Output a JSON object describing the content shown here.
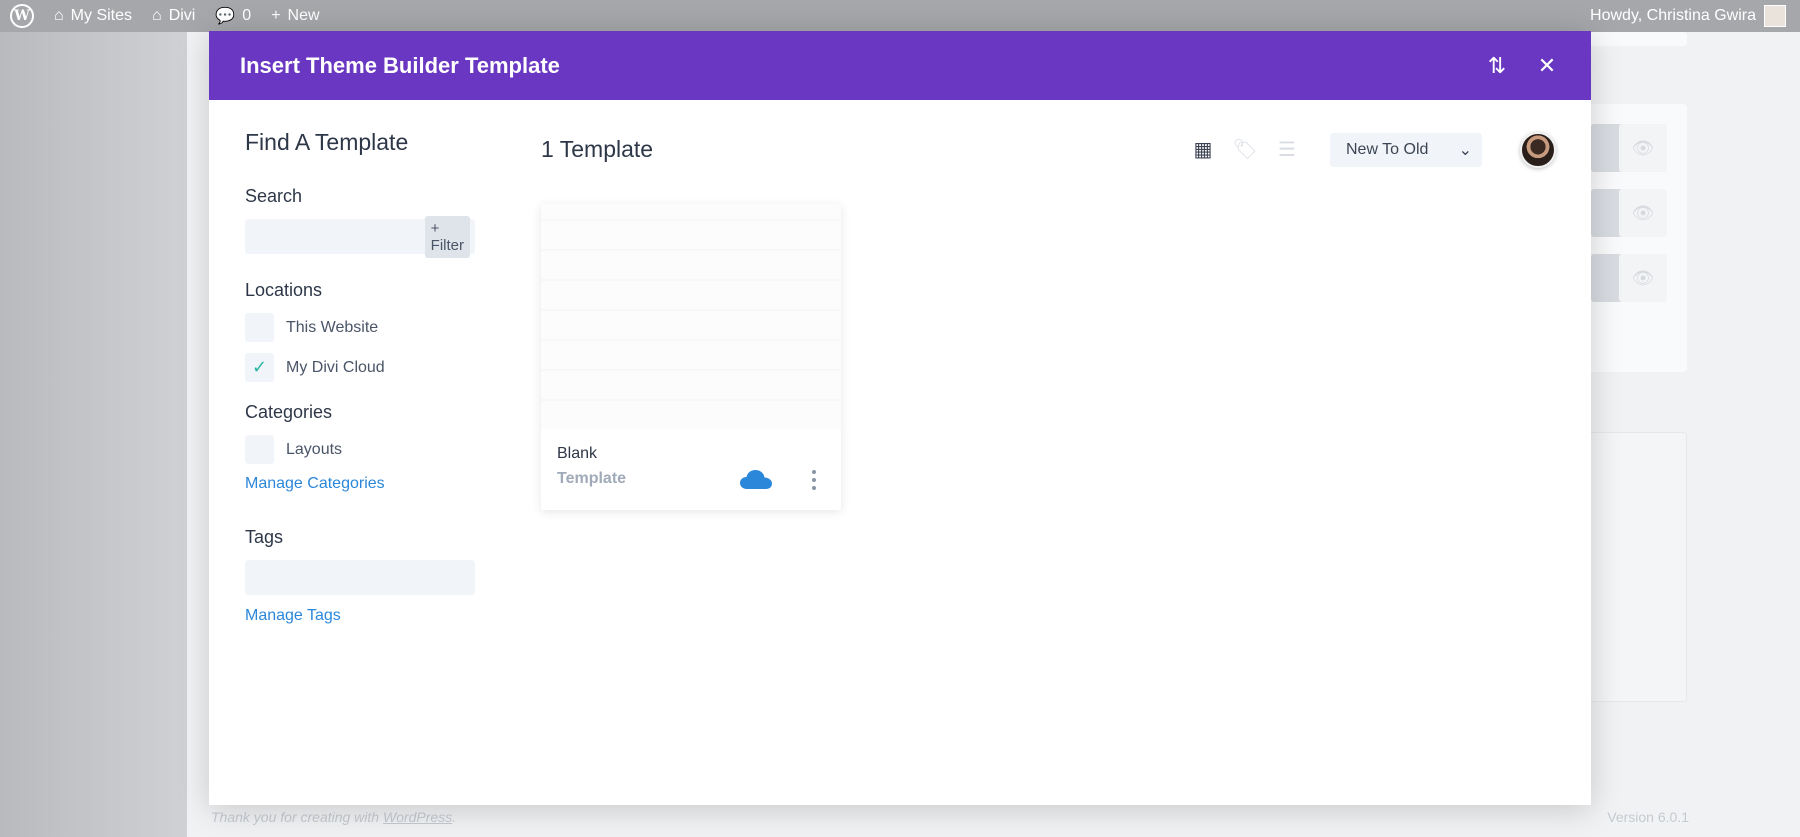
{
  "adminbar": {
    "wp_logo": "W",
    "my_sites": "My Sites",
    "site_name": "Divi",
    "comments": "0",
    "new": "New",
    "howdy": "Howdy, Christina Gwira"
  },
  "background": {
    "footer_text": "Thank you for creating with",
    "footer_link": "WordPress",
    "footer_period": ".",
    "version": "Version 6.0.1",
    "eye_icon": "👁"
  },
  "modal": {
    "title": "Insert Theme Builder Template",
    "icons": {
      "sort": "⇅",
      "close": "✕"
    },
    "sidebar": {
      "title": "Find A Template",
      "search_label": "Search",
      "search_placeholder": "",
      "filter_label": "+ Filter",
      "locations_label": "Locations",
      "locations": [
        {
          "label": "This Website",
          "checked": false,
          "mark": ""
        },
        {
          "label": "My Divi Cloud",
          "checked": true,
          "mark": "✓"
        }
      ],
      "categories_label": "Categories",
      "categories": [
        {
          "label": "Layouts",
          "checked": false,
          "mark": ""
        }
      ],
      "manage_categories": "Manage Categories",
      "tags_label": "Tags",
      "manage_tags": "Manage Tags"
    },
    "content": {
      "count_label": "1 Template",
      "view_icons": {
        "grid": "▦",
        "tag": "🏷",
        "list": "☰"
      },
      "sort_value": "New To Old",
      "sort_chevron": "⌄",
      "cards": [
        {
          "name": "Blank",
          "subtitle": "Template"
        }
      ]
    },
    "colors": {
      "header": "#6937c2",
      "link": "#2b87da",
      "check": "#2bb5a3",
      "cloud": "#2b87da"
    }
  }
}
